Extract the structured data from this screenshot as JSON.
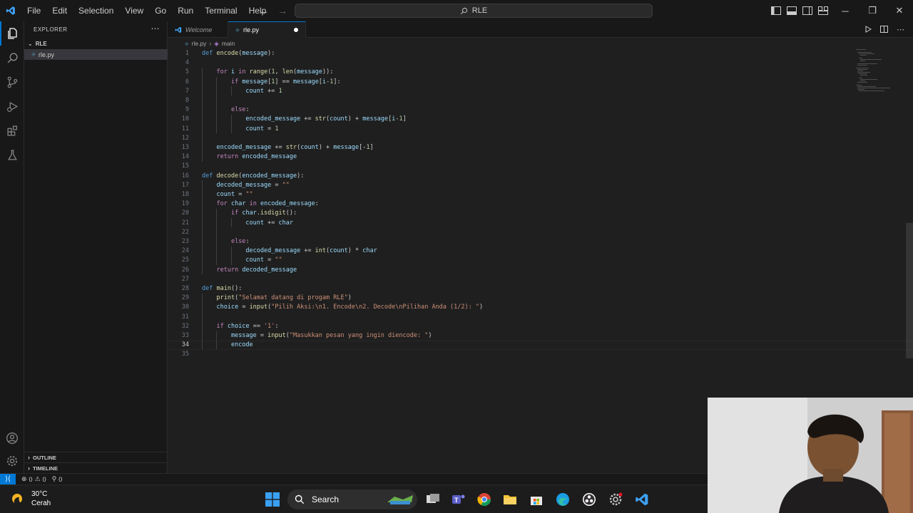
{
  "titlebar": {
    "menu": [
      "File",
      "Edit",
      "Selection",
      "View",
      "Go",
      "Run",
      "Terminal",
      "Help"
    ],
    "search_text": "RLE",
    "icons": [
      "vscode-logo-icon",
      "arrow-left-icon",
      "arrow-right-icon",
      "search-icon",
      "toggle-sidebar-icon",
      "toggle-panel-icon",
      "toggle-secondary-sidebar-icon",
      "customize-layout-icon"
    ],
    "window_controls": [
      "minimize",
      "restore",
      "close"
    ]
  },
  "activitybar": {
    "icons": [
      "explorer-icon",
      "search-icon",
      "source-control-icon",
      "run-debug-icon",
      "extensions-icon",
      "testing-icon",
      "account-icon",
      "settings-gear-icon"
    ]
  },
  "sidebar": {
    "title": "EXPLORER",
    "folder": "RLE",
    "file": "rle.py",
    "outline_label": "OUTLINE",
    "timeline_label": "TIMELINE"
  },
  "tabs": [
    {
      "label": "Welcome"
    },
    {
      "label": "rle.py"
    }
  ],
  "breadcrumb": {
    "file": "rle.py",
    "symbol": "main"
  },
  "code": {
    "current_line": 34,
    "lines": [
      {
        "n": "1",
        "text": "def encode(message):"
      },
      {
        "n": "4",
        "text": ""
      },
      {
        "n": "5",
        "text": "    for i in range(1, len(message)):"
      },
      {
        "n": "6",
        "text": "        if message[1] == message[i-1]:"
      },
      {
        "n": "7",
        "text": "            count += 1"
      },
      {
        "n": "8",
        "text": ""
      },
      {
        "n": "9",
        "text": "        else:"
      },
      {
        "n": "10",
        "text": "            encoded_message += str(count) + message[i-1]"
      },
      {
        "n": "11",
        "text": "            count = 1"
      },
      {
        "n": "12",
        "text": ""
      },
      {
        "n": "13",
        "text": "    encoded_message += str(count) + message[-1]"
      },
      {
        "n": "14",
        "text": "    return encoded_message"
      },
      {
        "n": "15",
        "text": ""
      },
      {
        "n": "16",
        "text": "def decode(encoded_message):"
      },
      {
        "n": "17",
        "text": "    decoded_message = \"\""
      },
      {
        "n": "18",
        "text": "    count = \"\""
      },
      {
        "n": "19",
        "text": "    for char in encoded_message:"
      },
      {
        "n": "20",
        "text": "        if char.isdigit():"
      },
      {
        "n": "21",
        "text": "            count += char"
      },
      {
        "n": "22",
        "text": ""
      },
      {
        "n": "23",
        "text": "        else:"
      },
      {
        "n": "24",
        "text": "            decoded_message += int(count) * char"
      },
      {
        "n": "25",
        "text": "            count = \"\""
      },
      {
        "n": "26",
        "text": "    return decoded_message"
      },
      {
        "n": "27",
        "text": ""
      },
      {
        "n": "28",
        "text": "def main():"
      },
      {
        "n": "29",
        "text": "    print(\"Selamat datang di progam RLE\")"
      },
      {
        "n": "30",
        "text": "    choice = input(\"Pilih Aksi:\\n1. Encode\\n2. Decode\\nPilihan Anda (1/2): \")"
      },
      {
        "n": "31",
        "text": ""
      },
      {
        "n": "32",
        "text": "    if choice == '1':"
      },
      {
        "n": "33",
        "text": "        message = input(\"Masukkan pesan yang ingin diencode: \")"
      },
      {
        "n": "34",
        "text": "        encode"
      },
      {
        "n": "35",
        "text": ""
      }
    ]
  },
  "statusbar": {
    "errors": "0",
    "warnings": "0",
    "ports": "0"
  },
  "taskbar": {
    "temperature": "30°C",
    "condition": "Cerah",
    "search_label": "Search",
    "apps": [
      "windows-start-icon",
      "search-icon",
      "task-view-icon",
      "teams-icon",
      "chrome-icon",
      "file-explorer-icon",
      "microsoft-store-icon",
      "edge-icon",
      "obs-icon",
      "settings-icon",
      "vscode-icon"
    ]
  },
  "colors": {
    "accent": "#0078d4",
    "keyword": "#c586c0",
    "def_keyword": "#569cd6",
    "function": "#dcdcaa",
    "variable": "#9cdcfe",
    "string": "#ce9178",
    "number": "#b5cea8",
    "builtin": "#4ec9b0"
  }
}
